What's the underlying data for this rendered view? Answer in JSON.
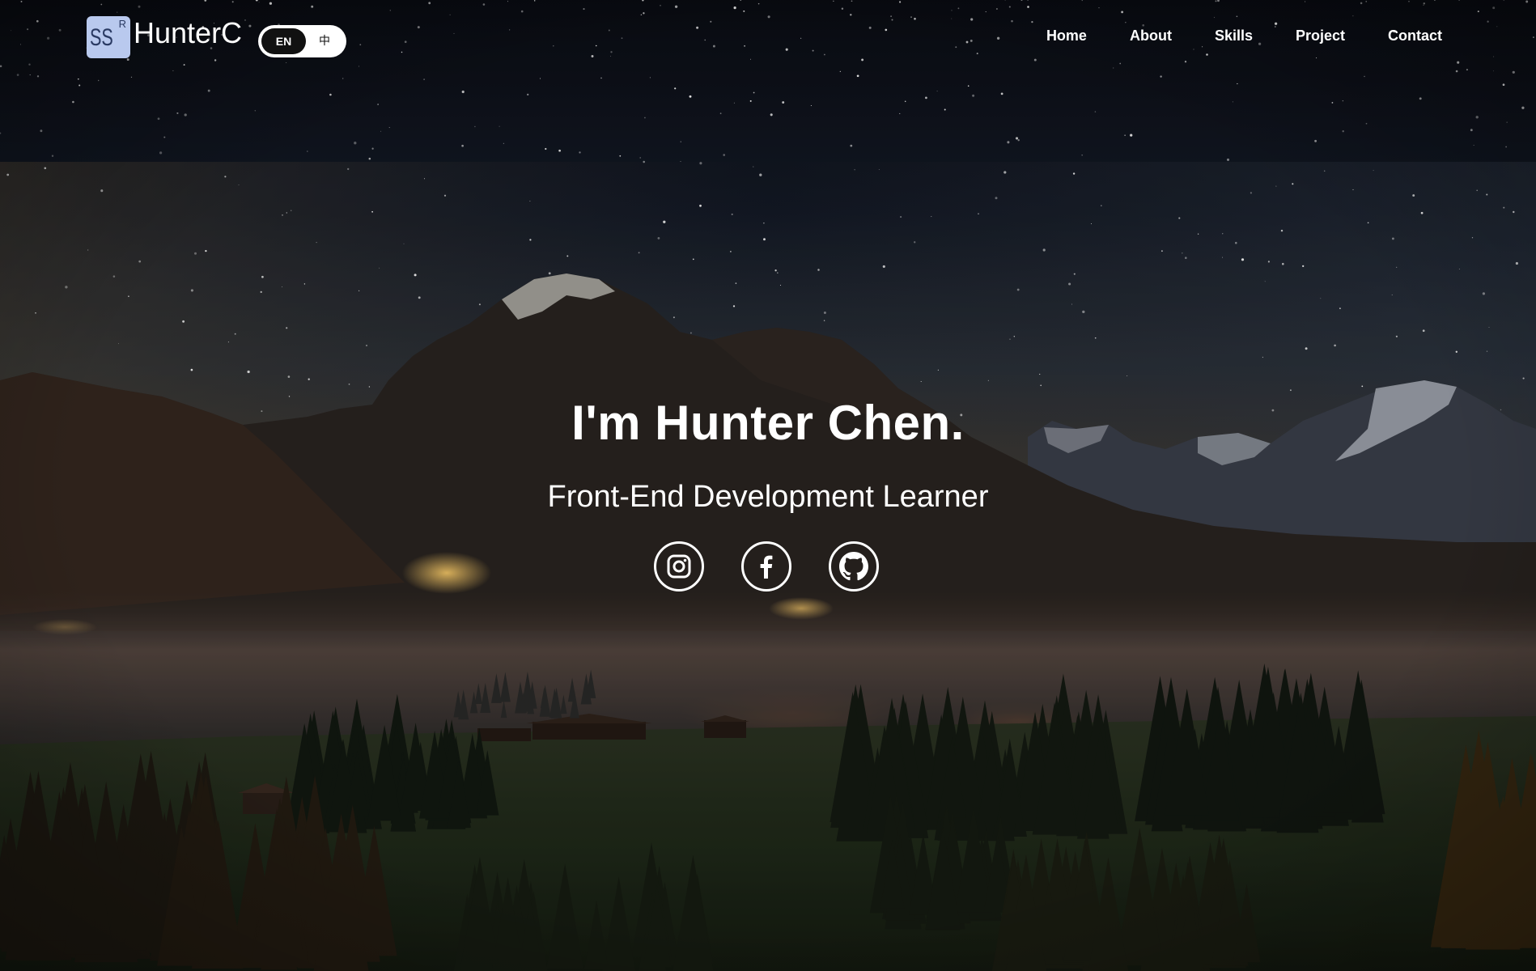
{
  "brand": {
    "logo_letters": "SS",
    "logo_superscript": "R",
    "name": "HunterC"
  },
  "language_toggle": {
    "active": "EN",
    "options": [
      "EN",
      "中"
    ]
  },
  "nav": {
    "items": [
      "Home",
      "About",
      "Skills",
      "Project",
      "Contact"
    ]
  },
  "hero": {
    "title": "I'm Hunter Chen.",
    "subtitle": "Front-End Development Learner"
  },
  "socials": [
    {
      "icon": "instagram-icon"
    },
    {
      "icon": "facebook-icon"
    },
    {
      "icon": "github-icon"
    }
  ],
  "colors": {
    "text": "#ffffff",
    "logo_bg": "#b9c9ee",
    "toggle_bg": "#ffffff",
    "toggle_active": "#111111"
  }
}
